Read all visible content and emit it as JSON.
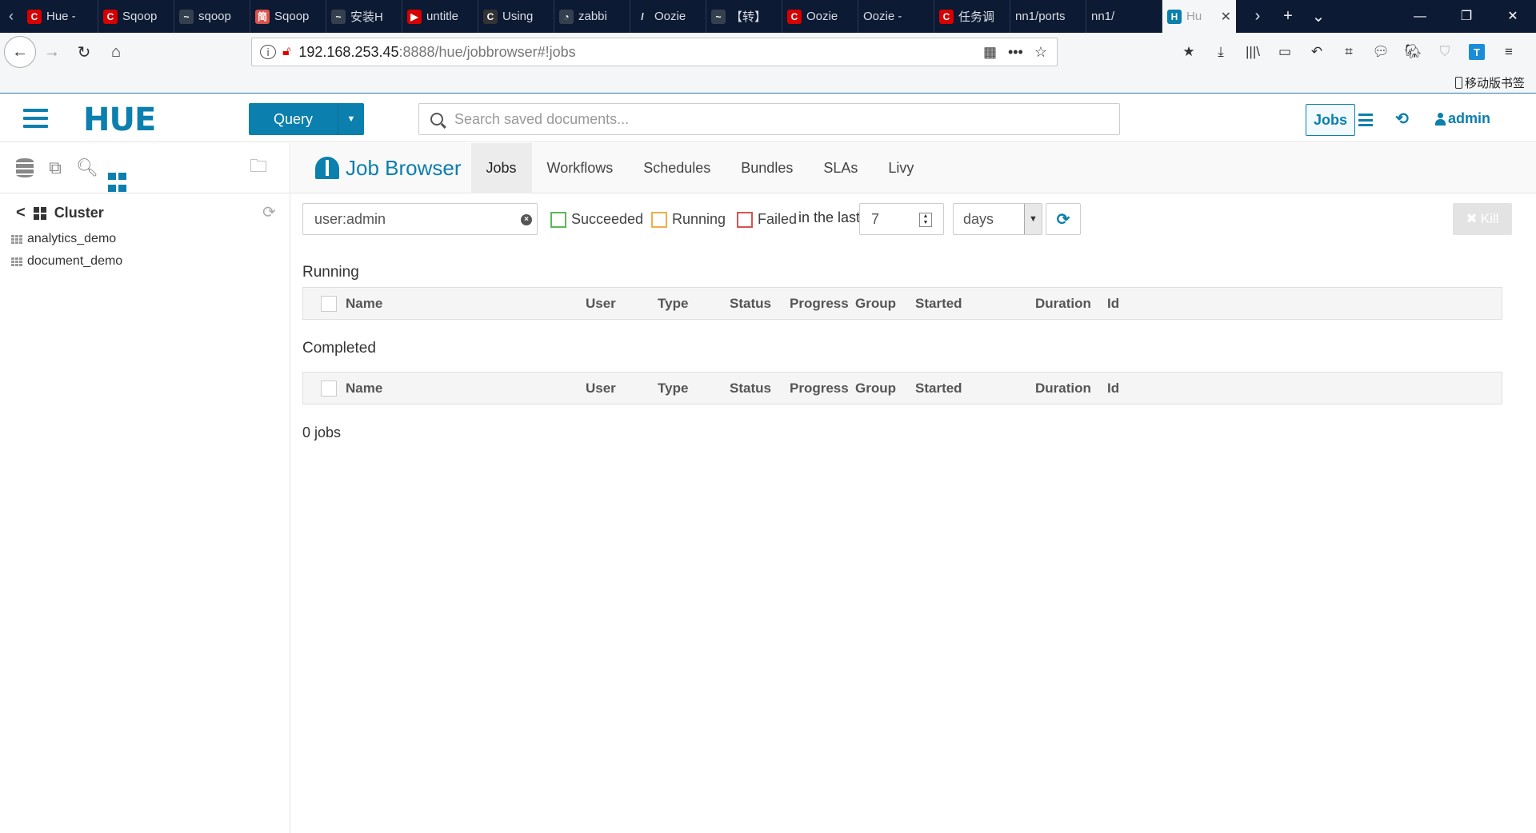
{
  "browser": {
    "tabs": [
      {
        "title": "Hue -",
        "fav": "C",
        "color": "#d60000"
      },
      {
        "title": "Sqoop",
        "fav": "C",
        "color": "#d60000"
      },
      {
        "title": "sqoop",
        "fav": "~",
        "color": "#35404f"
      },
      {
        "title": "Sqoop",
        "fav": "简",
        "color": "#d9534f"
      },
      {
        "title": "安装H",
        "fav": "~",
        "color": "#35404f"
      },
      {
        "title": "untitle",
        "fav": "▶",
        "color": "#d60000"
      },
      {
        "title": "Using",
        "fav": "C",
        "color": "#333"
      },
      {
        "title": "zabbi",
        "fav": "◔",
        "color": "#35404f"
      },
      {
        "title": "Oozie",
        "fav": "/",
        "color": "#0c1a33"
      },
      {
        "title": "【转】",
        "fav": "~",
        "color": "#35404f"
      },
      {
        "title": "Oozie",
        "fav": "C",
        "color": "#d60000"
      },
      {
        "title": "Oozie -",
        "fav": "",
        "color": "#0c1a33"
      },
      {
        "title": "任务调",
        "fav": "C",
        "color": "#d60000"
      },
      {
        "title": "nn1/ports",
        "fav": "",
        "color": "#0c1a33"
      },
      {
        "title": "nn1/",
        "fav": "",
        "color": "#0c1a33"
      }
    ],
    "active_tab": {
      "title": "Hu",
      "fav": "H"
    },
    "url_host": "192.168.253.45",
    "url_rest": ":8888/hue/jobbrowser#!jobs",
    "mobile_bookmarks": "移动版书签"
  },
  "hue": {
    "logo": "HUE",
    "query_label": "Query",
    "search_placeholder": "Search saved documents...",
    "jobs_label": "Jobs",
    "user_label": "admin"
  },
  "sidebar": {
    "cluster_label": "Cluster",
    "databases": [
      "analytics_demo",
      "document_demo"
    ]
  },
  "jobbrowser": {
    "title": "Job Browser",
    "tabs": [
      "Jobs",
      "Workflows",
      "Schedules",
      "Bundles",
      "SLAs",
      "Livy"
    ],
    "active_tab": "Jobs",
    "filter_value": "user:admin",
    "status_filters": {
      "succeeded": "Succeeded",
      "running": "Running",
      "failed": "Failed"
    },
    "in_the_last": "in the last",
    "days_value": "7",
    "days_unit": "days",
    "kill_label": "Kill",
    "running_title": "Running",
    "completed_title": "Completed",
    "columns": [
      "Name",
      "User",
      "Type",
      "Status",
      "Progress",
      "Group",
      "Started",
      "Duration",
      "Id"
    ],
    "jobs_count": "0 jobs"
  }
}
